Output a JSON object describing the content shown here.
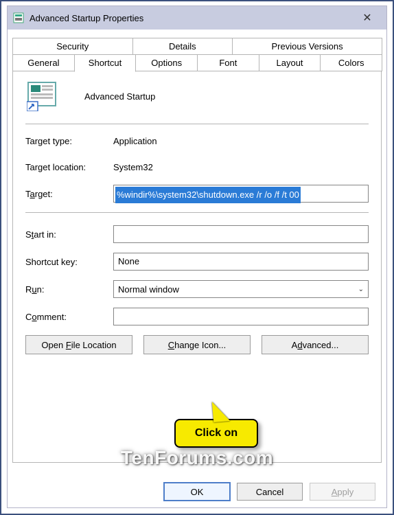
{
  "window": {
    "title": "Advanced Startup Properties",
    "close_label": "✕"
  },
  "tabs": {
    "row1": [
      "Security",
      "Details",
      "Previous Versions"
    ],
    "row2": [
      "General",
      "Shortcut",
      "Options",
      "Font",
      "Layout",
      "Colors"
    ],
    "active": "Shortcut"
  },
  "shortcut": {
    "name": "Advanced Startup",
    "target_type_label": "Target type:",
    "target_type": "Application",
    "target_location_label": "Target location:",
    "target_location": "System32",
    "target_label_pre": "T",
    "target_label_under": "a",
    "target_label_post": "rget:",
    "target_value": "%windir%\\system32\\shutdown.exe /r /o /f /t 00",
    "startin_label_pre": "S",
    "startin_label_under": "t",
    "startin_label_post": "art in:",
    "startin_value": "",
    "shortcutkey_label": "Shortcut key:",
    "shortcutkey_value": "None",
    "run_label_pre": "R",
    "run_label_under": "u",
    "run_label_post": "n:",
    "run_value": "Normal window",
    "comment_label_pre": "C",
    "comment_label_under": "o",
    "comment_label_post": "mment:",
    "comment_value": "",
    "btn_open_pre": "Open ",
    "btn_open_under": "F",
    "btn_open_post": "ile Location",
    "btn_change_pre": "",
    "btn_change_under": "C",
    "btn_change_post": "hange Icon...",
    "btn_adv_pre": "A",
    "btn_adv_under": "d",
    "btn_adv_post": "vanced..."
  },
  "buttons": {
    "ok": "OK",
    "cancel": "Cancel",
    "apply_pre": "",
    "apply_under": "A",
    "apply_post": "pply"
  },
  "callout": {
    "text": "Click on"
  },
  "watermark": "TenForums.com"
}
